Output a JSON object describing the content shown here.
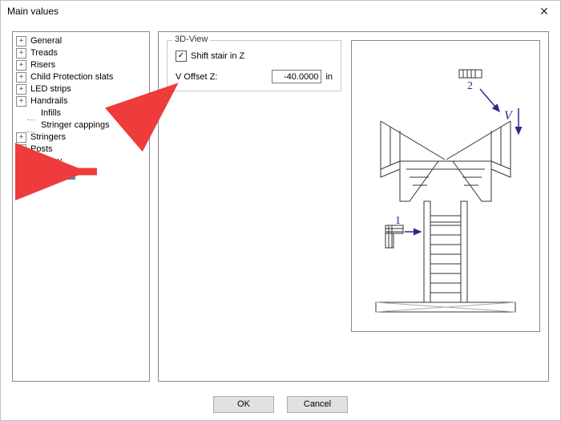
{
  "window": {
    "title": "Main values"
  },
  "tree": {
    "items": [
      {
        "label": "General",
        "expandable": true,
        "indent": 0
      },
      {
        "label": "Treads",
        "expandable": true,
        "indent": 0
      },
      {
        "label": "Risers",
        "expandable": true,
        "indent": 0
      },
      {
        "label": "Child Protection slats",
        "expandable": true,
        "indent": 0
      },
      {
        "label": "LED strips",
        "expandable": true,
        "indent": 0
      },
      {
        "label": "Handrails",
        "expandable": true,
        "indent": 0
      },
      {
        "label": "Infills",
        "expandable": false,
        "indent": 1
      },
      {
        "label": "Stringer cappings",
        "expandable": false,
        "indent": 1
      },
      {
        "label": "Stringers",
        "expandable": true,
        "indent": 0
      },
      {
        "label": "Posts",
        "expandable": true,
        "indent": 0
      },
      {
        "label": "Balcony",
        "expandable": true,
        "indent": 0
      },
      {
        "label": "3D-View",
        "expandable": false,
        "indent": 1,
        "selected": true
      }
    ]
  },
  "panel": {
    "legend": "3D-View",
    "shift_label": "Shift stair in Z",
    "shift_checked": true,
    "offset_label": "V Offset Z:",
    "offset_value": "-40.0000",
    "offset_unit": "in"
  },
  "diagram": {
    "label1": "1",
    "label2": "2",
    "labelV": "V"
  },
  "buttons": {
    "ok": "OK",
    "cancel": "Cancel"
  }
}
